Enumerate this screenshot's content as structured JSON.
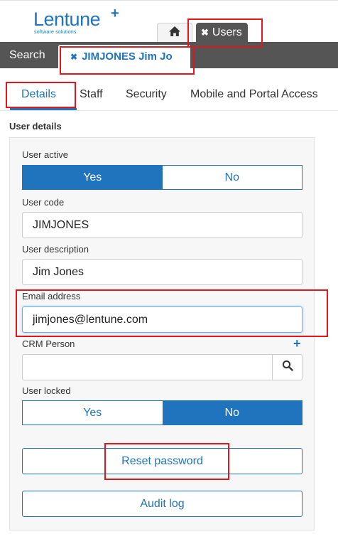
{
  "brand": {
    "name": "Lentune",
    "plus": "+",
    "tagline": "software solutions",
    "color": "#1f74bd"
  },
  "top_tabs": {
    "home_icon": "home-icon",
    "users_close": "✖",
    "users_label": "Users"
  },
  "tab_bar": {
    "search_label": "Search",
    "record_close": "✖",
    "record_label": "JIMJONES Jim Jo"
  },
  "sub_tabs": [
    {
      "label": "Details",
      "active": true
    },
    {
      "label": "Staff",
      "active": false
    },
    {
      "label": "Security",
      "active": false
    },
    {
      "label": "Mobile and Portal Access",
      "active": false
    }
  ],
  "section_title": "User details",
  "form": {
    "user_active": {
      "label": "User active",
      "options": [
        "Yes",
        "No"
      ],
      "selected": "Yes"
    },
    "user_code": {
      "label": "User code",
      "value": "JIMJONES"
    },
    "user_description": {
      "label": "User description",
      "value": "Jim Jones"
    },
    "email": {
      "label": "Email address",
      "value": "jimjones@lentune.com"
    },
    "crm_person": {
      "label": "CRM Person",
      "value": "",
      "add_icon": "plus-icon",
      "search_icon": "search-icon"
    },
    "user_locked": {
      "label": "User locked",
      "options": [
        "Yes",
        "No"
      ],
      "selected": "No"
    }
  },
  "actions": {
    "reset_password": "Reset password",
    "audit_log": "Audit log"
  },
  "colors": {
    "accent": "#1f74bd",
    "dark_bar": "#555555",
    "annotation": "#e3161c"
  }
}
